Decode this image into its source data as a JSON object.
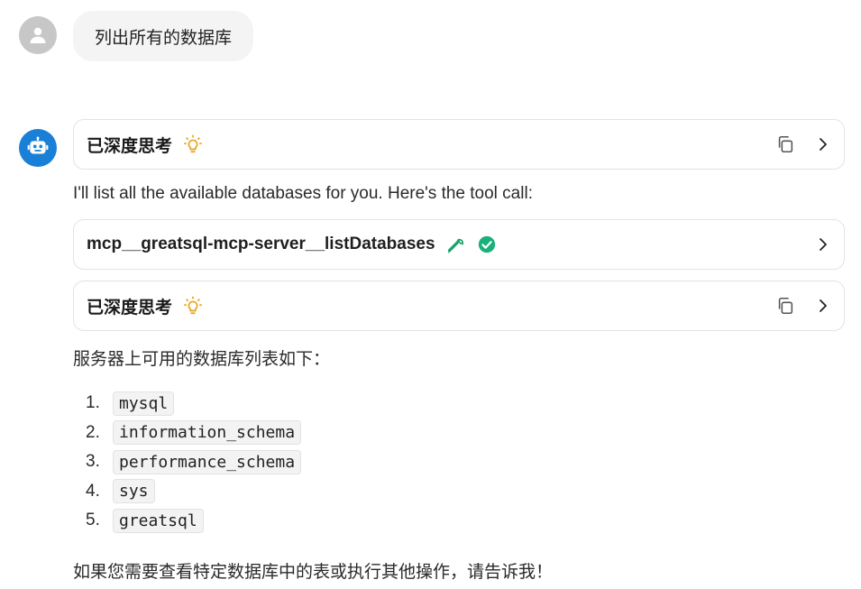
{
  "user_message": "列出所有的数据库",
  "thinking_panels": [
    {
      "label": "已深度思考"
    },
    {
      "label": "已深度思考"
    }
  ],
  "assistant_intro": "I'll list all the available databases for you. Here's the tool call:",
  "tool_call": {
    "name": "mcp__greatsql-mcp-server__listDatabases",
    "status": "success"
  },
  "result_heading": "服务器上可用的数据库列表如下：",
  "databases": [
    {
      "num": "1.",
      "name": "mysql"
    },
    {
      "num": "2.",
      "name": "information_schema"
    },
    {
      "num": "3.",
      "name": "performance_schema"
    },
    {
      "num": "4.",
      "name": "sys"
    },
    {
      "num": "5.",
      "name": "greatsql"
    }
  ],
  "closing": "如果您需要查看特定数据库中的表或执行其他操作，请告诉我！",
  "colors": {
    "bot_avatar": "#1a7fd6",
    "user_avatar": "#c7c7c7",
    "bulb": "#e8a317",
    "tool_icon": "#1aa36d",
    "check": "#19b07a"
  },
  "icons": [
    "user-icon",
    "robot-icon",
    "lightbulb-icon",
    "copy-icon",
    "chevron-right-icon",
    "wrench-icon",
    "check-circle-icon"
  ]
}
